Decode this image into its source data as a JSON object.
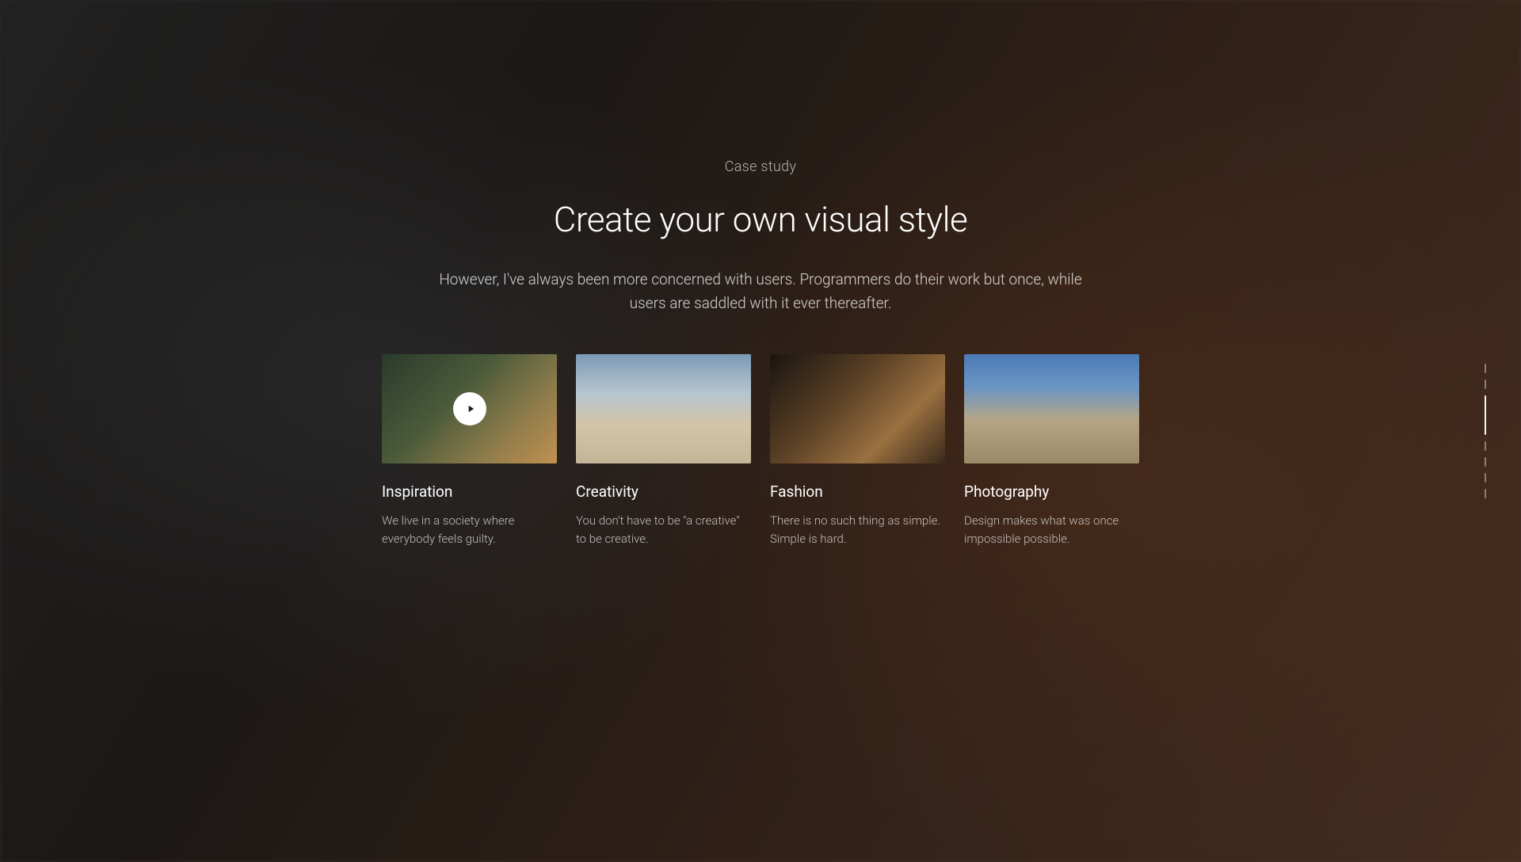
{
  "section": {
    "eyebrow": "Case study",
    "heading": "Create your own visual style",
    "subheading": "However, I've always been more concerned with users. Programmers do their work but once, while users are saddled with it ever thereafter."
  },
  "cards": [
    {
      "title": "Inspiration",
      "description": "We live in a society where everybody feels guilty.",
      "hasPlayButton": true
    },
    {
      "title": "Creativity",
      "description": "You don't have to be \"a creative\" to be creative.",
      "hasPlayButton": false
    },
    {
      "title": "Fashion",
      "description": "There is no such thing as simple. Simple is hard.",
      "hasPlayButton": false
    },
    {
      "title": "Photography",
      "description": "Design makes what was once impossible possible.",
      "hasPlayButton": false
    }
  ],
  "pageIndicator": {
    "totalPages": 7,
    "activePage": 2
  }
}
